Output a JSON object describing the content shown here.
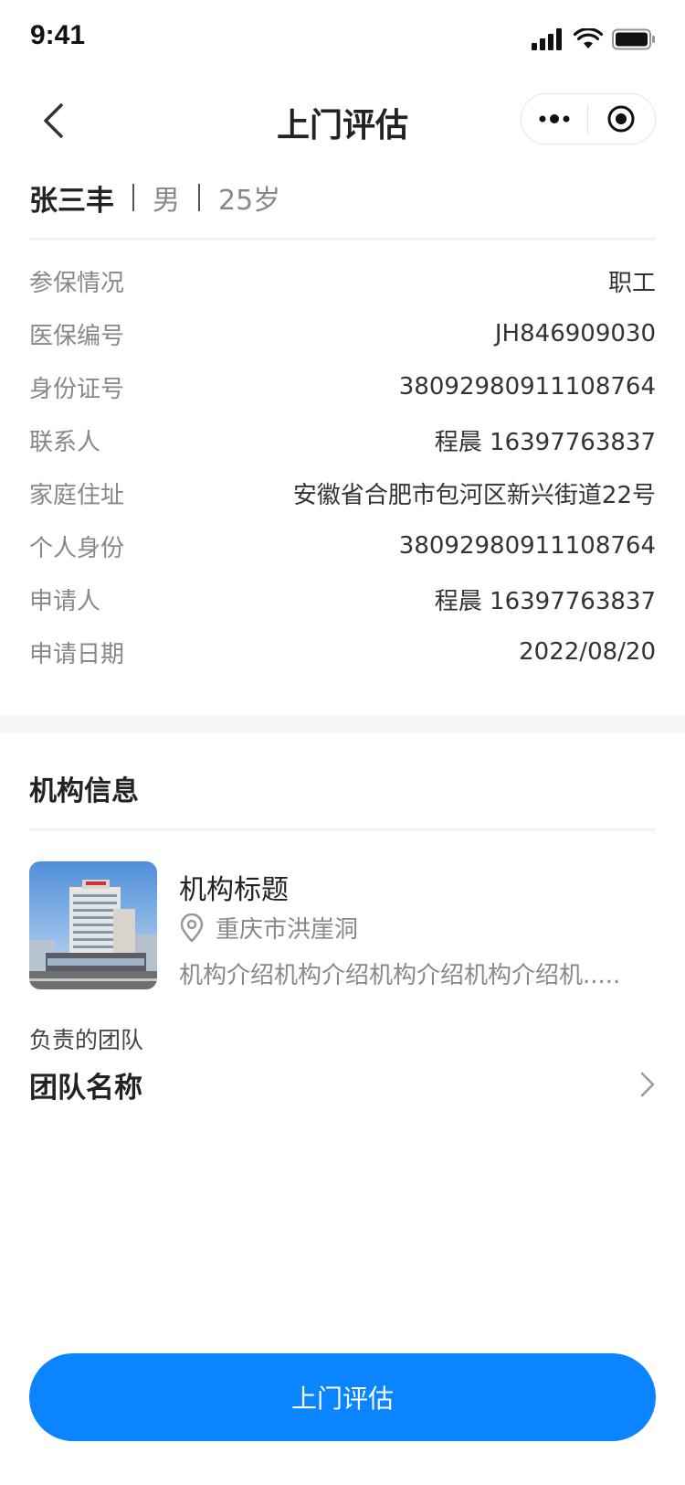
{
  "status_bar": {
    "time": "9:41",
    "icons": [
      "signal-icon",
      "wifi-icon",
      "battery-icon"
    ]
  },
  "nav": {
    "title": "上门评估",
    "back_icon": "chevron-left-icon",
    "capsule_icons": [
      "more-dots-icon",
      "target-icon"
    ]
  },
  "person": {
    "name": "张三丰",
    "gender": "男",
    "age": "25岁"
  },
  "info": [
    {
      "label": "参保情况",
      "value": "职工"
    },
    {
      "label": "医保编号",
      "value": "JH846909030"
    },
    {
      "label": "身份证号",
      "value": "38092980911108764"
    },
    {
      "label": "联系人",
      "value": "程晨 16397763837"
    },
    {
      "label": "家庭住址",
      "value": "安徽省合肥市包河区新兴街道22号"
    },
    {
      "label": "个人身份",
      "value": "38092980911108764"
    },
    {
      "label": "申请人",
      "value": "程晨 16397763837"
    },
    {
      "label": "申请日期",
      "value": "2022/08/20"
    }
  ],
  "org_section": {
    "title": "机构信息",
    "org": {
      "title": "机构标题",
      "location": "重庆市洪崖洞",
      "description": "机构介绍机构介绍机构介绍机构介绍机.....",
      "location_icon": "location-pin-icon"
    }
  },
  "team": {
    "label": "负责的团队",
    "name": "团队名称",
    "arrow_icon": "chevron-right-icon"
  },
  "action": {
    "button_label": "上门评估"
  },
  "colors": {
    "primary": "#0a84ff",
    "text_main": "#222222",
    "text_muted": "#888888",
    "divider": "#f2f2f2"
  }
}
